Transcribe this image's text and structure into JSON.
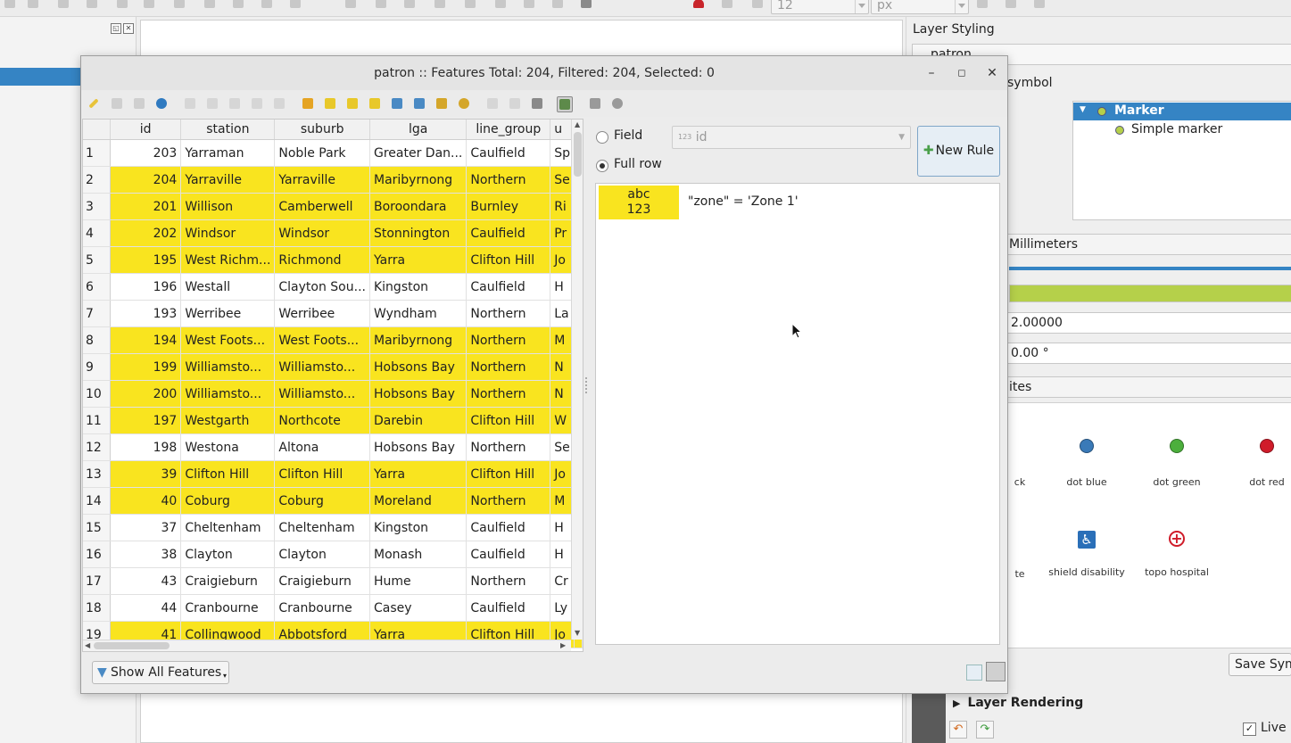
{
  "toolbar": {
    "size_value": "12",
    "unit_value": "px"
  },
  "right_panel": {
    "title": "Layer Styling",
    "layer_name": "patron",
    "symbol_label": "symbol",
    "tree_items": [
      "Marker",
      "Simple marker"
    ],
    "unit_label": "Millimeters",
    "size_value": "2.00000",
    "rotation_value": "0.00 °",
    "favorites_label": "ites",
    "symbols": [
      {
        "label": "ck",
        "color": ""
      },
      {
        "label": "dot blue",
        "color": "#3a7ab8"
      },
      {
        "label": "dot green",
        "color": "#4caf3c"
      },
      {
        "label": "dot red",
        "color": "#d01c2a"
      },
      {
        "label": "te",
        "color": ""
      },
      {
        "label": "shield disability",
        "color": "#2a6fb8"
      },
      {
        "label": "topo hospital",
        "color": "#d01c2a"
      }
    ],
    "save_button": "Save Symb",
    "layer_rendering": "Layer Rendering",
    "live_update": "Live u"
  },
  "dialog": {
    "title": "patron :: Features Total: 204, Filtered: 204, Selected: 0",
    "columns": [
      "id",
      "station",
      "suburb",
      "lga",
      "line_group",
      "u"
    ],
    "rows": [
      {
        "n": "1",
        "id": "203",
        "station": "Yarraman",
        "suburb": "Noble Park",
        "lga": "Greater Dan...",
        "line_group": "Caulfield",
        "u": "Sp",
        "hl": false
      },
      {
        "n": "2",
        "id": "204",
        "station": "Yarraville",
        "suburb": "Yarraville",
        "lga": "Maribyrnong",
        "line_group": "Northern",
        "u": "Se",
        "hl": true
      },
      {
        "n": "3",
        "id": "201",
        "station": "Willison",
        "suburb": "Camberwell",
        "lga": "Boroondara",
        "line_group": "Burnley",
        "u": "Ri",
        "hl": true
      },
      {
        "n": "4",
        "id": "202",
        "station": "Windsor",
        "suburb": "Windsor",
        "lga": "Stonnington",
        "line_group": "Caulfield",
        "u": "Pr",
        "hl": true
      },
      {
        "n": "5",
        "id": "195",
        "station": "West Richm...",
        "suburb": "Richmond",
        "lga": "Yarra",
        "line_group": "Clifton Hill",
        "u": "Jo",
        "hl": true
      },
      {
        "n": "6",
        "id": "196",
        "station": "Westall",
        "suburb": "Clayton Sou...",
        "lga": "Kingston",
        "line_group": "Caulfield",
        "u": "H",
        "hl": false
      },
      {
        "n": "7",
        "id": "193",
        "station": "Werribee",
        "suburb": "Werribee",
        "lga": "Wyndham",
        "line_group": "Northern",
        "u": "La",
        "hl": false
      },
      {
        "n": "8",
        "id": "194",
        "station": "West Foots...",
        "suburb": "West Foots...",
        "lga": "Maribyrnong",
        "line_group": "Northern",
        "u": "M",
        "hl": true
      },
      {
        "n": "9",
        "id": "199",
        "station": "Williamsto...",
        "suburb": "Williamsto...",
        "lga": "Hobsons Bay",
        "line_group": "Northern",
        "u": "N",
        "hl": true
      },
      {
        "n": "10",
        "id": "200",
        "station": "Williamsto...",
        "suburb": "Williamsto...",
        "lga": "Hobsons Bay",
        "line_group": "Northern",
        "u": "N",
        "hl": true
      },
      {
        "n": "11",
        "id": "197",
        "station": "Westgarth",
        "suburb": "Northcote",
        "lga": "Darebin",
        "line_group": "Clifton Hill",
        "u": "W",
        "hl": true
      },
      {
        "n": "12",
        "id": "198",
        "station": "Westona",
        "suburb": "Altona",
        "lga": "Hobsons Bay",
        "line_group": "Northern",
        "u": "Se",
        "hl": false
      },
      {
        "n": "13",
        "id": "39",
        "station": "Clifton Hill",
        "suburb": "Clifton Hill",
        "lga": "Yarra",
        "line_group": "Clifton Hill",
        "u": "Jo",
        "hl": true
      },
      {
        "n": "14",
        "id": "40",
        "station": "Coburg",
        "suburb": "Coburg",
        "lga": "Moreland",
        "line_group": "Northern",
        "u": "M",
        "hl": true
      },
      {
        "n": "15",
        "id": "37",
        "station": "Cheltenham",
        "suburb": "Cheltenham",
        "lga": "Kingston",
        "line_group": "Caulfield",
        "u": "H",
        "hl": false
      },
      {
        "n": "16",
        "id": "38",
        "station": "Clayton",
        "suburb": "Clayton",
        "lga": "Monash",
        "line_group": "Caulfield",
        "u": "H",
        "hl": false
      },
      {
        "n": "17",
        "id": "43",
        "station": "Craigieburn",
        "suburb": "Craigieburn",
        "lga": "Hume",
        "line_group": "Northern",
        "u": "Cr",
        "hl": false
      },
      {
        "n": "18",
        "id": "44",
        "station": "Cranbourne",
        "suburb": "Cranbourne",
        "lga": "Casey",
        "line_group": "Caulfield",
        "u": "Ly",
        "hl": false
      },
      {
        "n": "19",
        "id": "41",
        "station": "Collingwood",
        "suburb": "Abbotsford",
        "lga": "Yarra",
        "line_group": "Clifton Hill",
        "u": "Jo",
        "hl": true
      }
    ],
    "format_panel": {
      "field_label": "Field",
      "field_value": "id",
      "field_prefix": "123",
      "full_row_label": "Full row",
      "new_rule_button": "New Rule",
      "rules": [
        {
          "preview_top": "abc",
          "preview_bottom": "123",
          "expression": "\"zone\"  =  'Zone 1'",
          "color": "#f9e41f"
        }
      ]
    },
    "show_all_button": "Show All Features"
  }
}
